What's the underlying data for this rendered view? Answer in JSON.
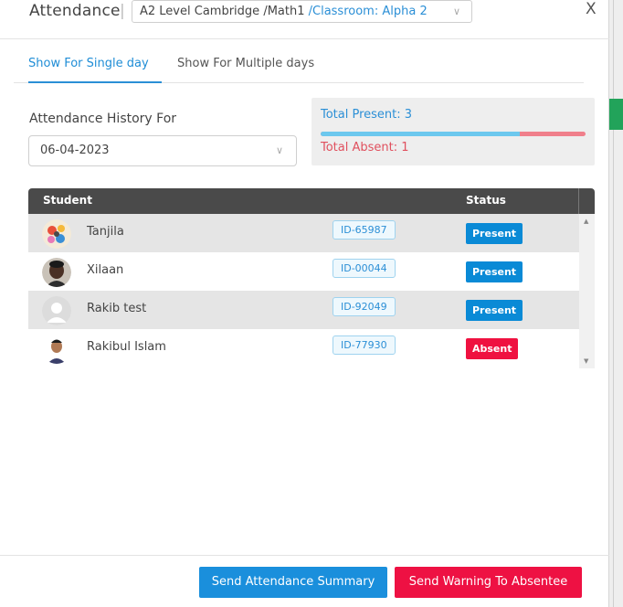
{
  "header": {
    "title": "Attendance",
    "separator": "|",
    "breadcrumb": {
      "level": "A2 Level Cambridge",
      "subject": "/Math1",
      "classroom": "/Classroom: Alpha 2"
    },
    "close_label": "X"
  },
  "tabs": [
    {
      "label": "Show For Single day",
      "active": true
    },
    {
      "label": "Show For Multiple days",
      "active": false
    }
  ],
  "history": {
    "label": "Attendance History For",
    "date": "06-04-2023"
  },
  "summary": {
    "present_label": "Total Present: 3",
    "absent_label": "Total Absent: 1",
    "present_fraction": 0.75,
    "present_color": "#6cc8ee",
    "absent_color": "#f07f8b"
  },
  "table": {
    "headers": {
      "student": "Student",
      "status": "Status"
    },
    "rows": [
      {
        "name": "Tanjila",
        "id": "ID-65987",
        "status": "Present",
        "avatar": "colorful-illustration-avatar"
      },
      {
        "name": "Xilaan",
        "id": "ID-00044",
        "status": "Present",
        "avatar": "photo-avatar"
      },
      {
        "name": "Rakib test",
        "id": "ID-92049",
        "status": "Present",
        "avatar": "default-person-avatar"
      },
      {
        "name": "Rakibul Islam",
        "id": "ID-77930",
        "status": "Absent",
        "avatar": "photo-avatar"
      }
    ]
  },
  "footer": {
    "summary_button": "Send Attendance Summary",
    "warning_button": "Send Warning To Absentee"
  },
  "colors": {
    "primary": "#1a8fdc",
    "danger": "#ee1143",
    "present_badge": "#0a8ad6",
    "absent_badge": "#ef1140",
    "table_header": "#4a4a4a"
  }
}
